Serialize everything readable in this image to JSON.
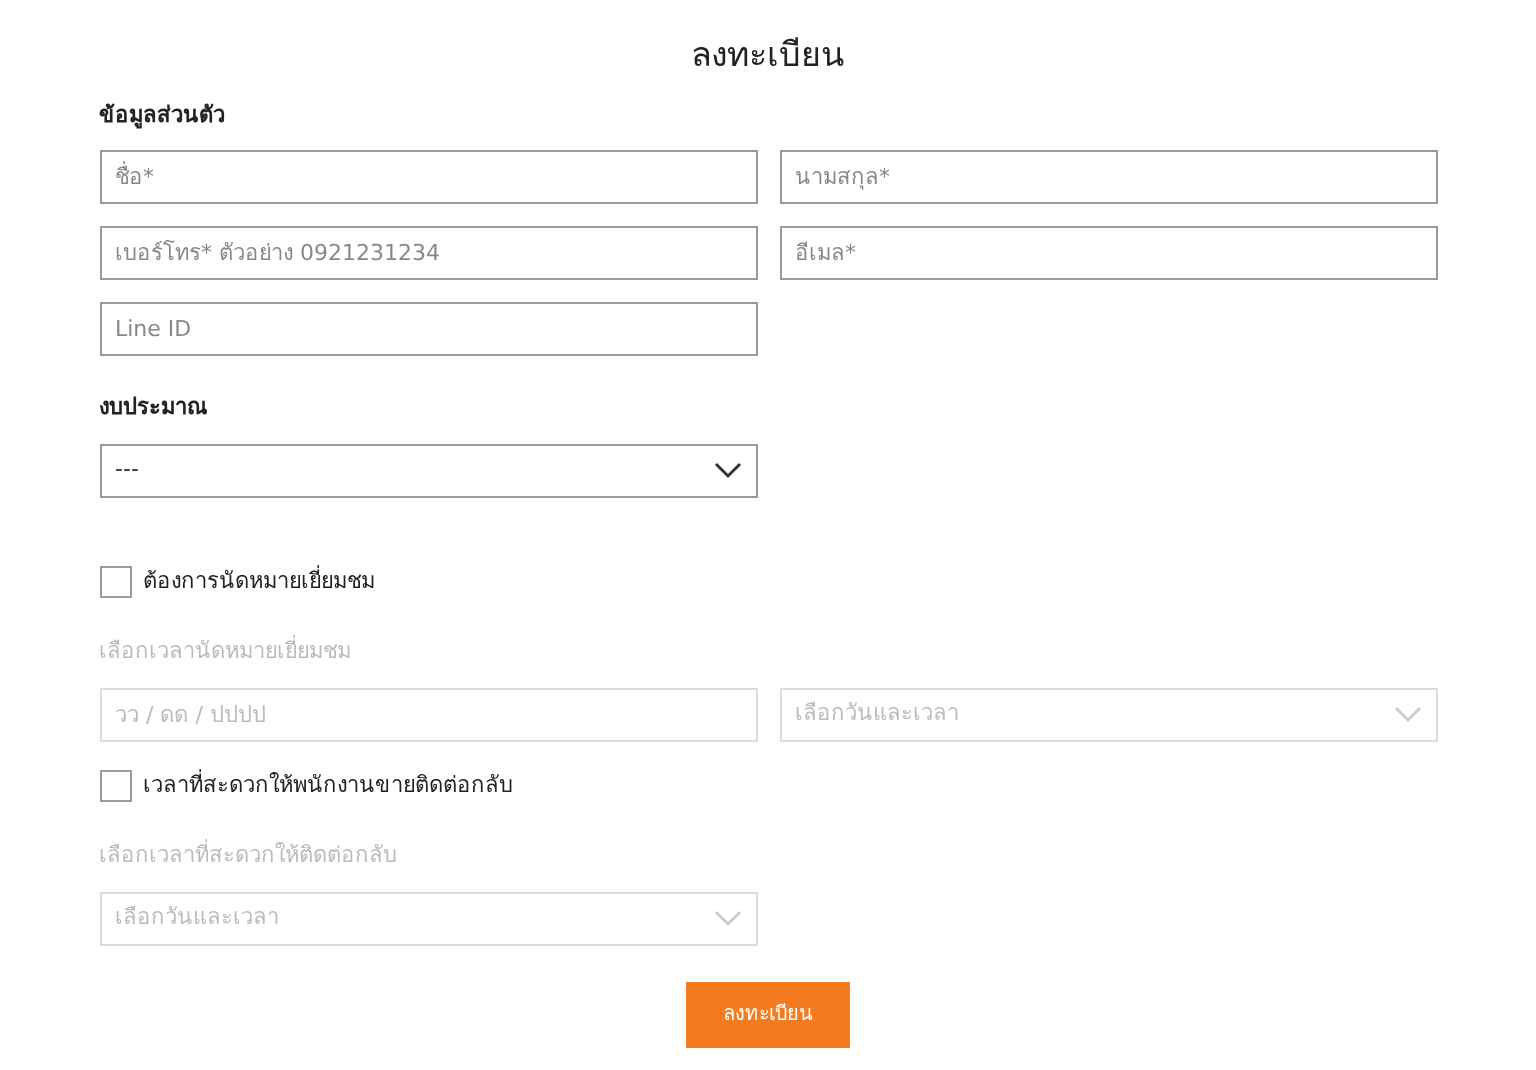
{
  "title": "ลงทะเบียน",
  "personal": {
    "heading": "ข้อมูลส่วนตัว",
    "fields": [
      {
        "placeholder": "ชื่อ*"
      },
      {
        "placeholder": "นามสกุล*"
      },
      {
        "placeholder": "เบอร์โทร* ตัวอย่าง 0921231234"
      },
      {
        "placeholder": "อีเมล*"
      },
      {
        "placeholder": "Line ID"
      }
    ]
  },
  "budget": {
    "label": "งบประมาณ",
    "value": "---",
    "disabled": false
  },
  "appointment": {
    "checkbox": {
      "label": "ต้องการนัดหมายเยี่ยมชม",
      "checked": false
    },
    "label": "เลือกเวลานัดหมายเยี่ยมชม",
    "disabled": true,
    "date_field": {
      "placeholder": "วว / ดด / ปปปป",
      "disabled": true
    },
    "time_select": {
      "value": "เลือกวันและเวลา",
      "disabled": true
    }
  },
  "callback": {
    "checkbox": {
      "label": "เวลาที่สะดวกให้พนักงานขายติดต่อกลับ",
      "checked": false
    },
    "label": "เลือกเวลาที่สะดวกให้ติดต่อกลับ",
    "disabled": true,
    "time_select": {
      "value": "เลือกวันและเวลา",
      "disabled": true
    }
  },
  "submit_button": "ลงทะเบียน"
}
